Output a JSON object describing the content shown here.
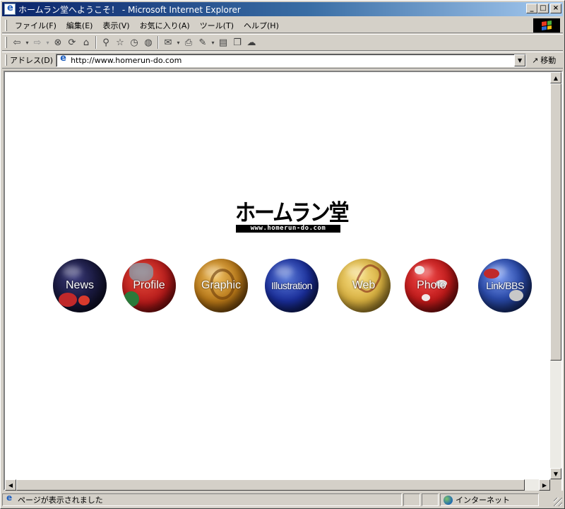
{
  "window": {
    "title": "ホームラン堂へようこそ！ - Microsoft Internet Explorer",
    "buttons": {
      "minimize": "_",
      "maximize": "□",
      "close": "×"
    }
  },
  "menu": {
    "items": [
      "ファイル(F)",
      "編集(E)",
      "表示(V)",
      "お気に入り(A)",
      "ツール(T)",
      "ヘルプ(H)"
    ]
  },
  "toolbar": {
    "icons": [
      "back-icon",
      "forward-icon",
      "stop-icon",
      "refresh-icon",
      "home-icon",
      "search-icon",
      "favorites-icon",
      "history-icon",
      "media-icon",
      "mail-icon",
      "print-icon",
      "edit-icon",
      "discuss-icon",
      "messenger-icon"
    ]
  },
  "address": {
    "label": "アドレス(D)",
    "url": "http://www.homerun-do.com",
    "go_label": "移動"
  },
  "page": {
    "logo_main": "ホームラン堂",
    "logo_url": "www.homerun-do.com",
    "nav": [
      {
        "label": "News"
      },
      {
        "label": "Profile"
      },
      {
        "label": "Graphic"
      },
      {
        "label": "Illustration"
      },
      {
        "label": "Web"
      },
      {
        "label": "Photo"
      },
      {
        "label": "Link/BBS"
      }
    ]
  },
  "status": {
    "message": "ページが表示されました",
    "zone": "インターネット"
  },
  "colors": {
    "titlebar_start": "#0a246a",
    "titlebar_end": "#a6caf0",
    "chrome": "#d4d0c8"
  }
}
